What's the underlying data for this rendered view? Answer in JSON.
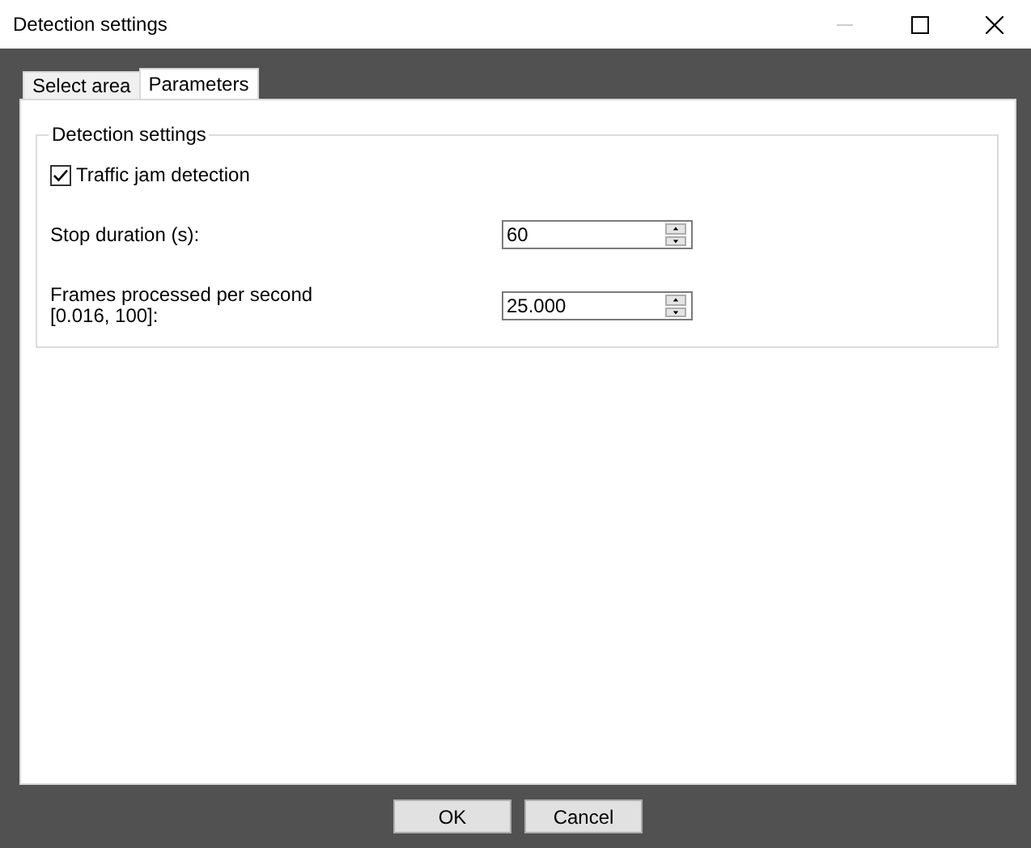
{
  "window": {
    "title": "Detection settings"
  },
  "tabs": [
    {
      "label": "Select area",
      "selected": false
    },
    {
      "label": "Parameters",
      "selected": true
    }
  ],
  "group": {
    "title": "Detection settings",
    "rows": [
      {
        "kind": "checkbox",
        "label": "Traffic jam detection",
        "checked": true
      },
      {
        "kind": "spin",
        "label": "Stop duration (s):",
        "value": "60"
      },
      {
        "kind": "spin",
        "label": "Frames processed per second\n[0.016, 100]:",
        "value": "25.000"
      }
    ]
  },
  "buttons": [
    "OK",
    "Cancel"
  ]
}
